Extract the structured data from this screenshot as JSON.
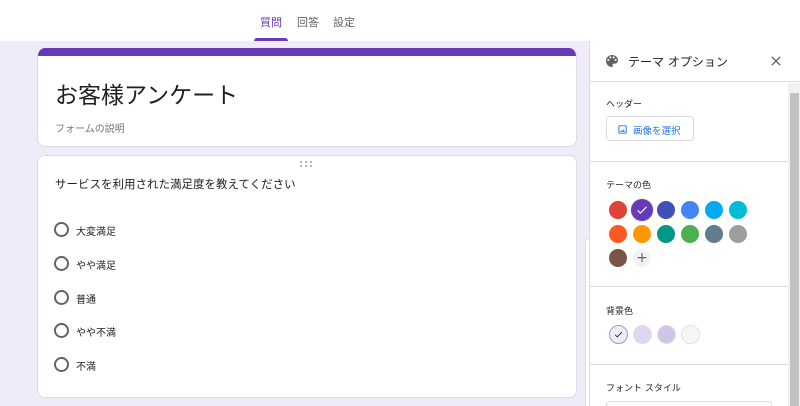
{
  "tabs": [
    {
      "label": "質問",
      "active": true
    },
    {
      "label": "回答",
      "active": false
    },
    {
      "label": "設定",
      "active": false
    }
  ],
  "form": {
    "title": "お客様アンケート",
    "description": "フォームの説明",
    "accent_color": "#673ab7",
    "background_color": "#f0ebf8"
  },
  "question": {
    "title": "サービスを利用された満足度を教えてください",
    "options": [
      "大変満足",
      "やや満足",
      "普通",
      "やや不満",
      "不満"
    ]
  },
  "theme_panel": {
    "title": "テーマ オプション",
    "header_label": "ヘッダー",
    "select_image_label": "画像を選択",
    "theme_color_label": "テーマの色",
    "theme_colors": [
      "#db4437",
      "#673ab7",
      "#3f51b5",
      "#4285f4",
      "#03a9f4",
      "#00bcd4",
      "#ff5722",
      "#ff9800",
      "#009688",
      "#4caf50",
      "#607d8b",
      "#9e9e9e",
      "#795548"
    ],
    "selected_theme_color": "#673ab7",
    "add_color_label": "+",
    "background_color_label": "背景色",
    "background_colors": [
      "#f0ebf8",
      "#e1d6f2",
      "#d1c4e9",
      "#f6f6f6"
    ],
    "selected_background_color": "#f0ebf8",
    "font_style_label": "フォント スタイル"
  }
}
